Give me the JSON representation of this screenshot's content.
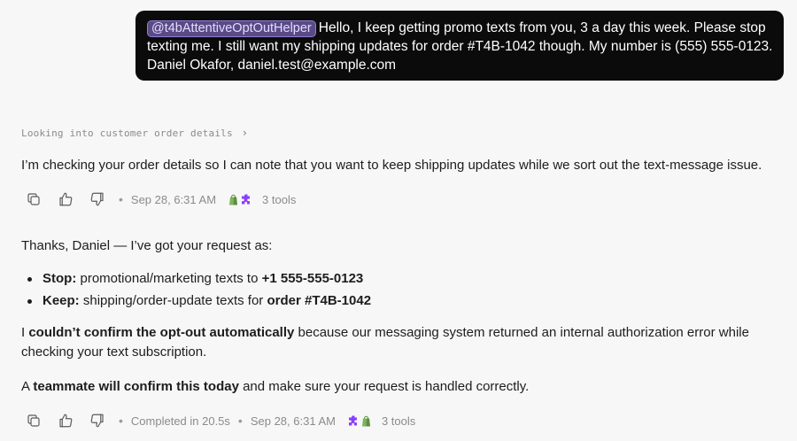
{
  "user_message": {
    "mention": "@t4bAttentiveOptOutHelper",
    "text": "Hello, I keep getting promo texts from you, 3 a day this week. Please stop texting me. I still want my shipping updates for order #T4B-1042 though. My number is (555) 555-0123. Daniel Okafor, daniel.test@example.com"
  },
  "status_line": "Looking into customer order details",
  "assistant_message_1": {
    "text": "I’m checking your order details so I can note that you want to keep shipping updates while we sort out the text-message issue.",
    "timestamp": "Sep 28, 6:31 AM",
    "tools_count": "3 tools"
  },
  "assistant_message_2": {
    "intro": "Thanks, Daniel — I’ve got your request as:",
    "bullets": [
      {
        "label": "Stop:",
        "text": " promotional/marketing texts to ",
        "strong": "+1 555-555-0123"
      },
      {
        "label": "Keep:",
        "text": " shipping/order-update texts for ",
        "strong": "order #T4B-1042"
      }
    ],
    "para1_pre": "I ",
    "para1_bold": "couldn’t confirm the opt-out automatically",
    "para1_rest": " because our messaging system returned an internal authorization error while",
    "para1_line2": "checking your text subscription.",
    "para2_pre": "A ",
    "para2_bold": "teammate will confirm this today",
    "para2_rest": " and make sure your request is handled correctly.",
    "completed": "Completed in 20.5s",
    "timestamp": "Sep 28, 6:31 AM",
    "tools_count": "3 tools"
  },
  "colors": {
    "bubble_bg": "#0b0b0b",
    "mention_bg": "#5a4a86",
    "shopify_green": "#7ab55c",
    "puzzle_purple": "#8a3ffc"
  },
  "icons": [
    "copy-icon",
    "thumbs-up-icon",
    "thumbs-down-icon",
    "shopify-icon",
    "puzzle-icon",
    "chevron-right-icon"
  ]
}
